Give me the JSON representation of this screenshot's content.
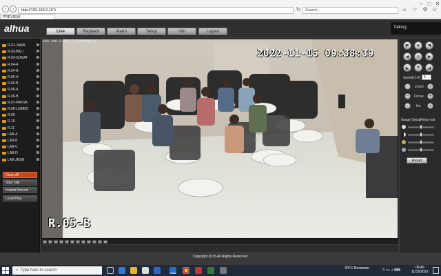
{
  "browser": {
    "url": "http://192.168.2.167/",
    "search_placeholder": "Search...",
    "tab_label": "PREVIEW"
  },
  "app": {
    "logo": "alhua",
    "tabs": [
      {
        "label": "Live"
      },
      {
        "label": "Playback"
      },
      {
        "label": "Alarm"
      },
      {
        "label": "Setup"
      },
      {
        "label": "Info"
      },
      {
        "label": "Logout"
      }
    ],
    "talking_label": "Talking:",
    "footer": "Copyright 2015,All Rights Reserved."
  },
  "cameras": [
    {
      "name": "R.01-JAWA",
      "mark": "M"
    },
    {
      "name": "R.02-BALI",
      "mark": "M"
    },
    {
      "name": "R.03-SUMAT",
      "mark": "M"
    },
    {
      "name": "R.04-A",
      "mark": "M"
    },
    {
      "name": "R.04-B",
      "mark": "M"
    },
    {
      "name": "R.05-A",
      "mark": "M"
    },
    {
      "name": "R.05-B",
      "mark": "M"
    },
    {
      "name": "R.06-A",
      "mark": "M"
    },
    {
      "name": "R.06-B",
      "mark": "M"
    },
    {
      "name": "R.07-PAPUA",
      "mark": "M"
    },
    {
      "name": "R.08-LOMBO",
      "mark": "M"
    },
    {
      "name": "R.09",
      "mark": "M"
    },
    {
      "name": "R.10",
      "mark": "M"
    },
    {
      "name": "R.11",
      "mark": "M"
    },
    {
      "name": "LAB-A",
      "mark": "M"
    },
    {
      "name": "LAB-B",
      "mark": "M"
    },
    {
      "name": "LAB-C",
      "mark": "M"
    },
    {
      "name": "LAB-D",
      "mark": "M"
    },
    {
      "name": "LAB-JRSN",
      "mark": "M"
    }
  ],
  "left_buttons": [
    {
      "label": "Close All"
    },
    {
      "label": "Start Talk"
    },
    {
      "label": "Instant Record"
    },
    {
      "label": "Local Play"
    }
  ],
  "video": {
    "caption": "192.168.2.167_7_1066kbps_M",
    "timestamp": "2022-11-15 09:38:39",
    "room": "R.05-B"
  },
  "ptz": {
    "speed_label": "Speed(1-8)",
    "speed_value": "5",
    "zoom_label": "Zoom",
    "focus_label": "Focus",
    "iris_label": "Iris",
    "image_setup_label": "Image Setup",
    "relay_label": "Relay-out",
    "reset_label": "Reset"
  },
  "taskbar": {
    "search_placeholder": "Type here to search",
    "weather": "30°C  Berawan",
    "time": "09:40",
    "date": "11/15/2022"
  }
}
